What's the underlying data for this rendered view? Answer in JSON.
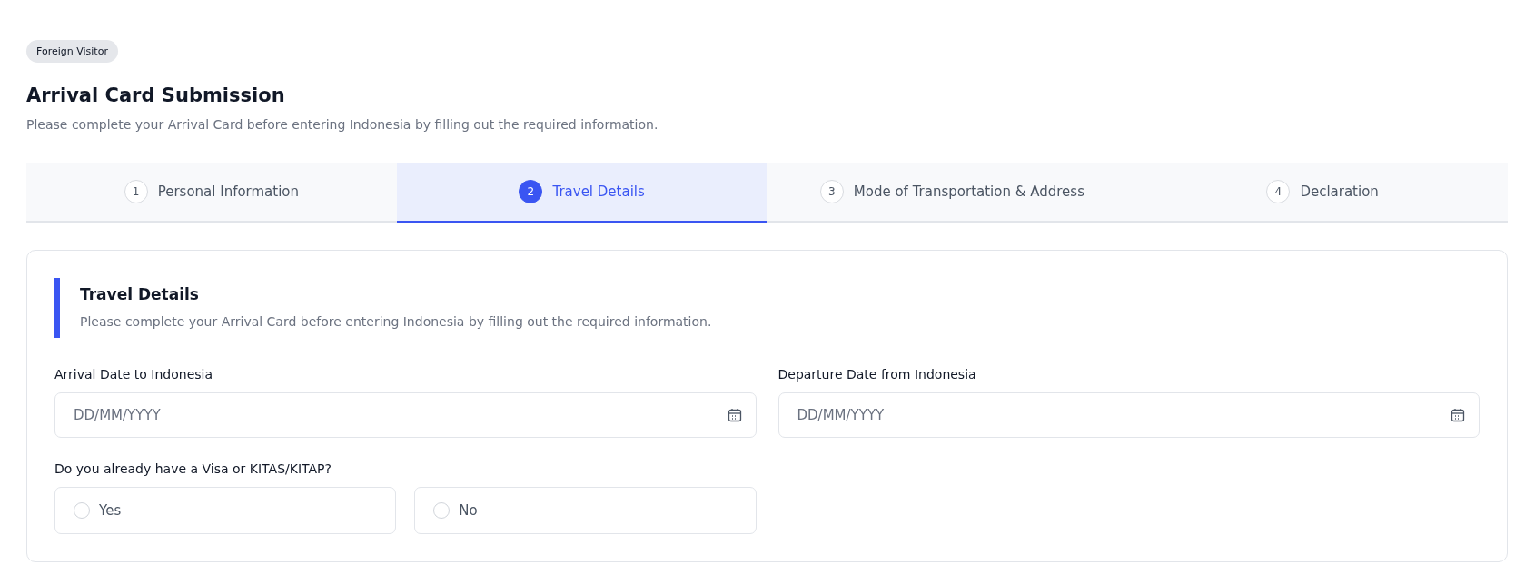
{
  "badge": "Foreign Visitor",
  "title": "Arrival Card Submission",
  "subtitle": "Please complete your Arrival Card before entering Indonesia by filling out the required information.",
  "steps": [
    {
      "number": "1",
      "label": "Personal Information",
      "selected": false
    },
    {
      "number": "2",
      "label": "Travel Details",
      "selected": true
    },
    {
      "number": "3",
      "label": "Mode of Transportation & Address",
      "selected": false
    },
    {
      "number": "4",
      "label": "Declaration",
      "selected": false
    }
  ],
  "section": {
    "title": "Travel Details",
    "description": "Please complete your Arrival Card before entering Indonesia by filling out the required information."
  },
  "date_fields": [
    {
      "label": "Arrival Date to Indonesia",
      "placeholder": "DD/MM/YYYY"
    },
    {
      "label": "Departure Date from Indonesia",
      "placeholder": "DD/MM/YYYY"
    }
  ],
  "visa_question": {
    "label": "Do you already have a Visa or KITAS/KITAP?",
    "options": [
      {
        "label": "Yes",
        "selected": false
      },
      {
        "label": "No",
        "selected": false
      }
    ]
  }
}
